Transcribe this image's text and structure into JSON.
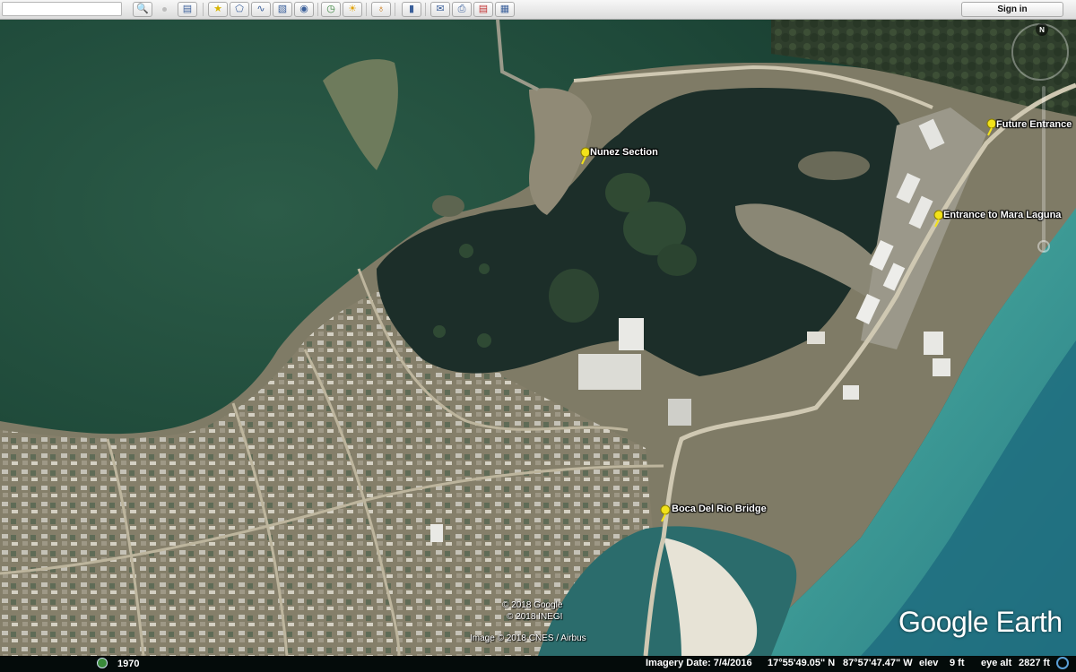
{
  "toolbar": {
    "search_value": "",
    "buttons": [
      {
        "name": "search-button",
        "glyph": "🔍"
      },
      {
        "name": "sidebar-toggle-button",
        "glyph": "▯"
      },
      {
        "name": "add-placemark-button",
        "glyph": "✰"
      },
      {
        "name": "add-polygon-button",
        "glyph": "⬠"
      },
      {
        "name": "add-path-button",
        "glyph": "〰"
      },
      {
        "name": "add-image-overlay-button",
        "glyph": "▭"
      },
      {
        "name": "record-tour-button",
        "glyph": "◉"
      },
      {
        "name": "historical-imagery-button",
        "glyph": "◷"
      },
      {
        "name": "sunlight-button",
        "glyph": "☀"
      },
      {
        "name": "switch-to-sky-button",
        "glyph": "♁"
      },
      {
        "name": "ruler-button",
        "glyph": "▮"
      },
      {
        "name": "email-button",
        "glyph": "✉"
      },
      {
        "name": "print-button",
        "glyph": "⎙"
      },
      {
        "name": "view-in-maps-button",
        "glyph": "▤"
      },
      {
        "name": "save-image-button",
        "glyph": "▦"
      }
    ],
    "sign_in_label": "Sign in"
  },
  "placemarks": [
    {
      "label": "Nunez Section"
    },
    {
      "label": "Future Entrance"
    },
    {
      "label": "Entrance to Mara Laguna"
    },
    {
      "label": "Boca Del Rio Bridge"
    }
  ],
  "attribution": {
    "line1": "© 2018 Google",
    "line2": "© 2018 INEGI",
    "line3": "Image © 2018 CNES / Airbus"
  },
  "logo": "Google Earth",
  "nav": {
    "north_label": "N"
  },
  "status": {
    "year": "1970",
    "imagery_date": "Imagery Date: 7/4/2016",
    "latitude": "17°55'49.05\" N",
    "longitude": "87°57'47.47\" W",
    "elev_label": "elev",
    "elev_value": "9 ft",
    "eye_alt_label": "eye alt",
    "eye_alt_value": "2827 ft"
  },
  "colors": {
    "toolbar_bg": "#e6e6e6",
    "sea_dark": "#1f4a3a",
    "lagoon": "#1b2f2a",
    "reef_turquoise": "#4aa8a0",
    "land": "#8a8a72",
    "pin_yellow": "#f2e21a"
  }
}
